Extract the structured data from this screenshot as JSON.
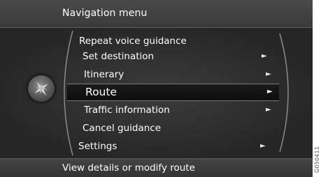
{
  "header": {
    "title": "Navigation menu"
  },
  "menu": {
    "items": [
      {
        "label": "Repeat voice guidance",
        "submenu": false
      },
      {
        "label": "Set destination",
        "submenu": true
      },
      {
        "label": "Itinerary",
        "submenu": true
      },
      {
        "label": "Route",
        "submenu": true,
        "selected": true
      },
      {
        "label": "Traffic information",
        "submenu": true
      },
      {
        "label": "Cancel guidance",
        "submenu": false
      },
      {
        "label": "Settings",
        "submenu": true
      }
    ],
    "arrow_glyph": "►"
  },
  "footer": {
    "text": "View details or modify route"
  },
  "watermark": "G050411",
  "icons": {
    "knob": "compass-rose-icon"
  },
  "colors": {
    "background": "#2b2b2b",
    "selected_bar": "#111111",
    "text": "#ffffff"
  }
}
